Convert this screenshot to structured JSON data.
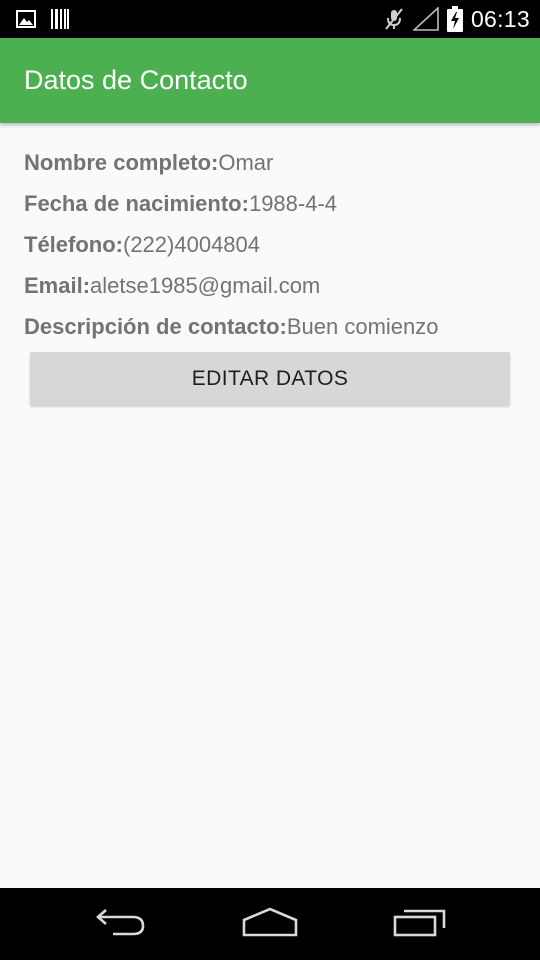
{
  "status_bar": {
    "time": "06:13",
    "icons": [
      "picture-icon",
      "barcode-icon",
      "mute-icon",
      "signal-icon",
      "battery-charging-icon"
    ]
  },
  "app_bar": {
    "title": "Datos de Contacto",
    "color": "#4caf50"
  },
  "contact": {
    "fields": [
      {
        "label": "Nombre completo:",
        "value": "Omar"
      },
      {
        "label": "Fecha de nacimiento:",
        "value": "1988-4-4"
      },
      {
        "label": "Télefono:",
        "value": "(222)4004804"
      },
      {
        "label": "Email:",
        "value": "aletse1985@gmail.com"
      },
      {
        "label": "Descripción de contacto:",
        "value": "Buen comienzo"
      }
    ]
  },
  "actions": {
    "edit_label": "EDITAR DATOS"
  },
  "nav_bar": {
    "buttons": [
      "back-icon",
      "home-icon",
      "recents-icon"
    ]
  }
}
